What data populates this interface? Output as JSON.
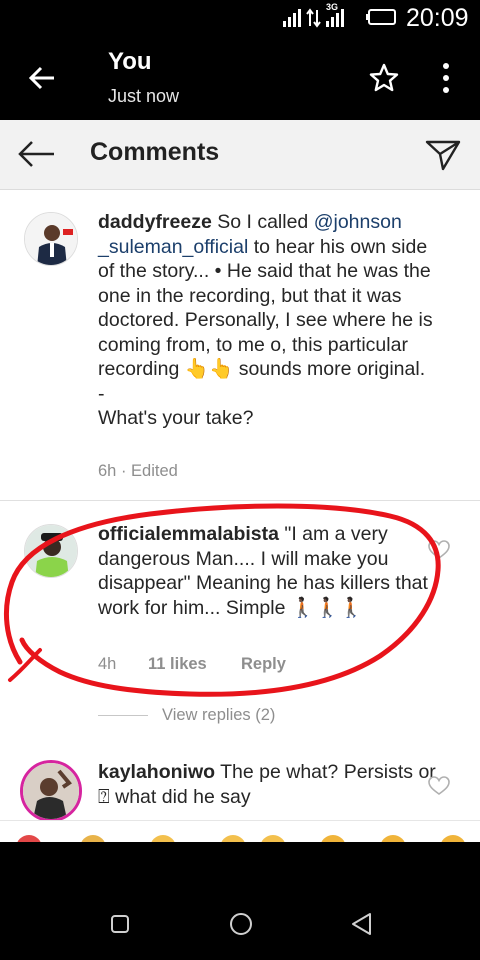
{
  "status_bar": {
    "network": "3G",
    "time": "20:09"
  },
  "top_bar": {
    "title": "You",
    "subtitle": "Just now"
  },
  "comments_header": {
    "title": "Comments"
  },
  "comments": [
    {
      "username": "daddyfreeze",
      "text_lines": [
        "So I called ",
        "@johnson _suleman_official",
        " to hear his own side of the story... • He said that he was the one in the recording, but that it was doctored. Personally, I see where he is coming from, to me o, this particular recording 👆👆 sounds more original.",
        "-",
        "What's your take?"
      ],
      "time": "6h",
      "edited": "· Edited"
    },
    {
      "username": "officialemmalabista",
      "text": "\"I am a very dangerous Man.... I will make you disappear\" Meaning he has killers that work for him... Simple 🚶🏿🚶🏿🚶🏿",
      "time": "4h",
      "likes": "11 likes",
      "reply": "Reply",
      "view_replies": "View replies (2)"
    },
    {
      "username": "kaylahoniwo",
      "text": "The pe what? Persists or ⍰ what did he say"
    }
  ],
  "colors": {
    "annotation": "#e8141b",
    "mention": "#1c3f6b",
    "meta": "#8e8e8e"
  },
  "icons": [
    "back-arrow-icon",
    "star-icon",
    "more-vert-icon",
    "send-icon",
    "heart-icon",
    "nav-recents-icon",
    "nav-home-icon",
    "nav-back-icon"
  ]
}
